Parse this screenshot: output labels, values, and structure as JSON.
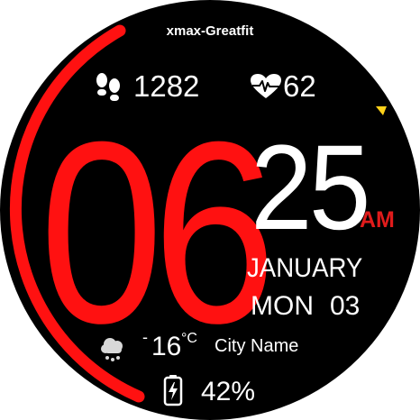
{
  "brand": "xmax-Greatfit",
  "steps": {
    "value": "1282",
    "icon": "footprints-icon"
  },
  "heart_rate": {
    "value": "62",
    "icon": "heart-pulse-icon"
  },
  "time": {
    "hours": "06",
    "minutes": "25",
    "ampm": "AM"
  },
  "date": {
    "month": "JANUARY",
    "weekday": "MON",
    "day": "03"
  },
  "weather": {
    "icon": "cloud-rain-icon",
    "temp_sign": "-",
    "temp": "16",
    "unit": "°C",
    "city": "City Name"
  },
  "battery": {
    "value": "42%",
    "icon": "battery-charging-icon"
  },
  "progress_arc": {
    "fraction": 0.34
  },
  "colors": {
    "accent": "#ff1111",
    "ampm": "#e01b1b",
    "indicator": "#ffd21a",
    "background": "#000000",
    "text": "#ffffff"
  }
}
